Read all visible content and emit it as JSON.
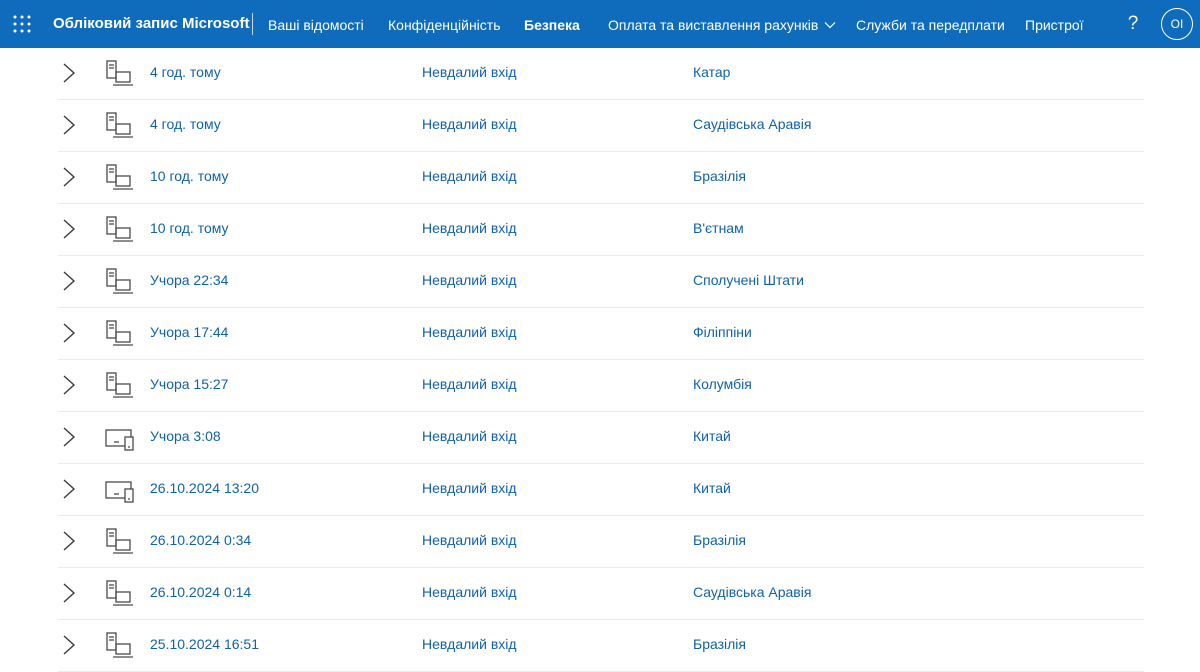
{
  "header": {
    "apps_icon": "waffle-grid-icon",
    "brand": "Обліковий запис Microsoft",
    "nav": [
      {
        "label": "Ваші відомості",
        "active": false
      },
      {
        "label": "Конфіденційність",
        "active": false
      },
      {
        "label": "Безпека",
        "active": true
      },
      {
        "label": "Оплата та виставлення рахунків",
        "active": false,
        "has_dropdown": true
      },
      {
        "label": "Служби та передплати",
        "active": false
      },
      {
        "label": "Пристрої",
        "active": false
      }
    ],
    "help": "?",
    "avatar_initials": "OI",
    "background_color": "#0f6cbd"
  },
  "activity": {
    "rows": [
      {
        "time": "4 год. тому",
        "status": "Невдалий вхід",
        "location": "Катар",
        "device": "desktop"
      },
      {
        "time": "4 год. тому",
        "status": "Невдалий вхід",
        "location": "Саудівська Аравія",
        "device": "desktop"
      },
      {
        "time": "10 год. тому",
        "status": "Невдалий вхід",
        "location": "Бразілія",
        "device": "desktop"
      },
      {
        "time": "10 год. тому",
        "status": "Невдалий вхід",
        "location": "В'єтнам",
        "device": "desktop"
      },
      {
        "time": "Учора 22:34",
        "status": "Невдалий вхід",
        "location": "Сполучені Штати",
        "device": "desktop"
      },
      {
        "time": "Учора 17:44",
        "status": "Невдалий вхід",
        "location": "Філіппіни",
        "device": "desktop"
      },
      {
        "time": "Учора 15:27",
        "status": "Невдалий вхід",
        "location": "Колумбія",
        "device": "desktop"
      },
      {
        "time": "Учора 3:08",
        "status": "Невдалий вхід",
        "location": "Китай",
        "device": "multi-device"
      },
      {
        "time": "26.10.2024 13:20",
        "status": "Невдалий вхід",
        "location": "Китай",
        "device": "multi-device"
      },
      {
        "time": "26.10.2024 0:34",
        "status": "Невдалий вхід",
        "location": "Бразілія",
        "device": "desktop"
      },
      {
        "time": "26.10.2024 0:14",
        "status": "Невдалий вхід",
        "location": "Саудівська Аравія",
        "device": "desktop"
      },
      {
        "time": "25.10.2024 16:51",
        "status": "Невдалий вхід",
        "location": "Бразілія",
        "device": "desktop"
      }
    ],
    "link_color": "#1060b0"
  }
}
